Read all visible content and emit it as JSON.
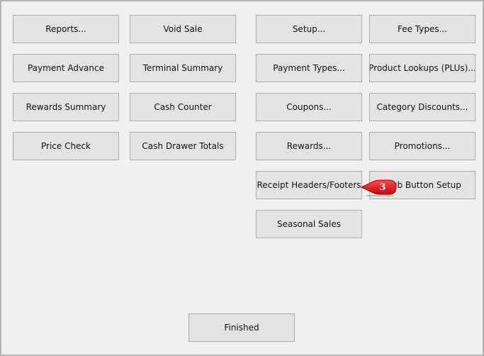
{
  "buttons": {
    "reports": "Reports...",
    "void_sale": "Void Sale",
    "setup": "Setup...",
    "fee_types": "Fee Types...",
    "payment_advance": "Payment Advance",
    "terminal_summary": "Terminal Summary",
    "payment_types": "Payment Types...",
    "product_lookups": "Product Lookups (PLUs)...",
    "rewards_summary": "Rewards Summary",
    "cash_counter": "Cash Counter",
    "coupons": "Coupons...",
    "category_discounts": "Category Discounts...",
    "price_check": "Price Check",
    "cash_drawer_totals": "Cash Drawer Totals",
    "rewards": "Rewards...",
    "promotions": "Promotions...",
    "receipt_headers_footers": "Receipt Headers/Footers",
    "club_button_setup": "Club Button Setup",
    "seasonal_sales": "Seasonal Sales",
    "finished": "Finished"
  },
  "callout": {
    "number": "3",
    "color": "#e8151b"
  }
}
